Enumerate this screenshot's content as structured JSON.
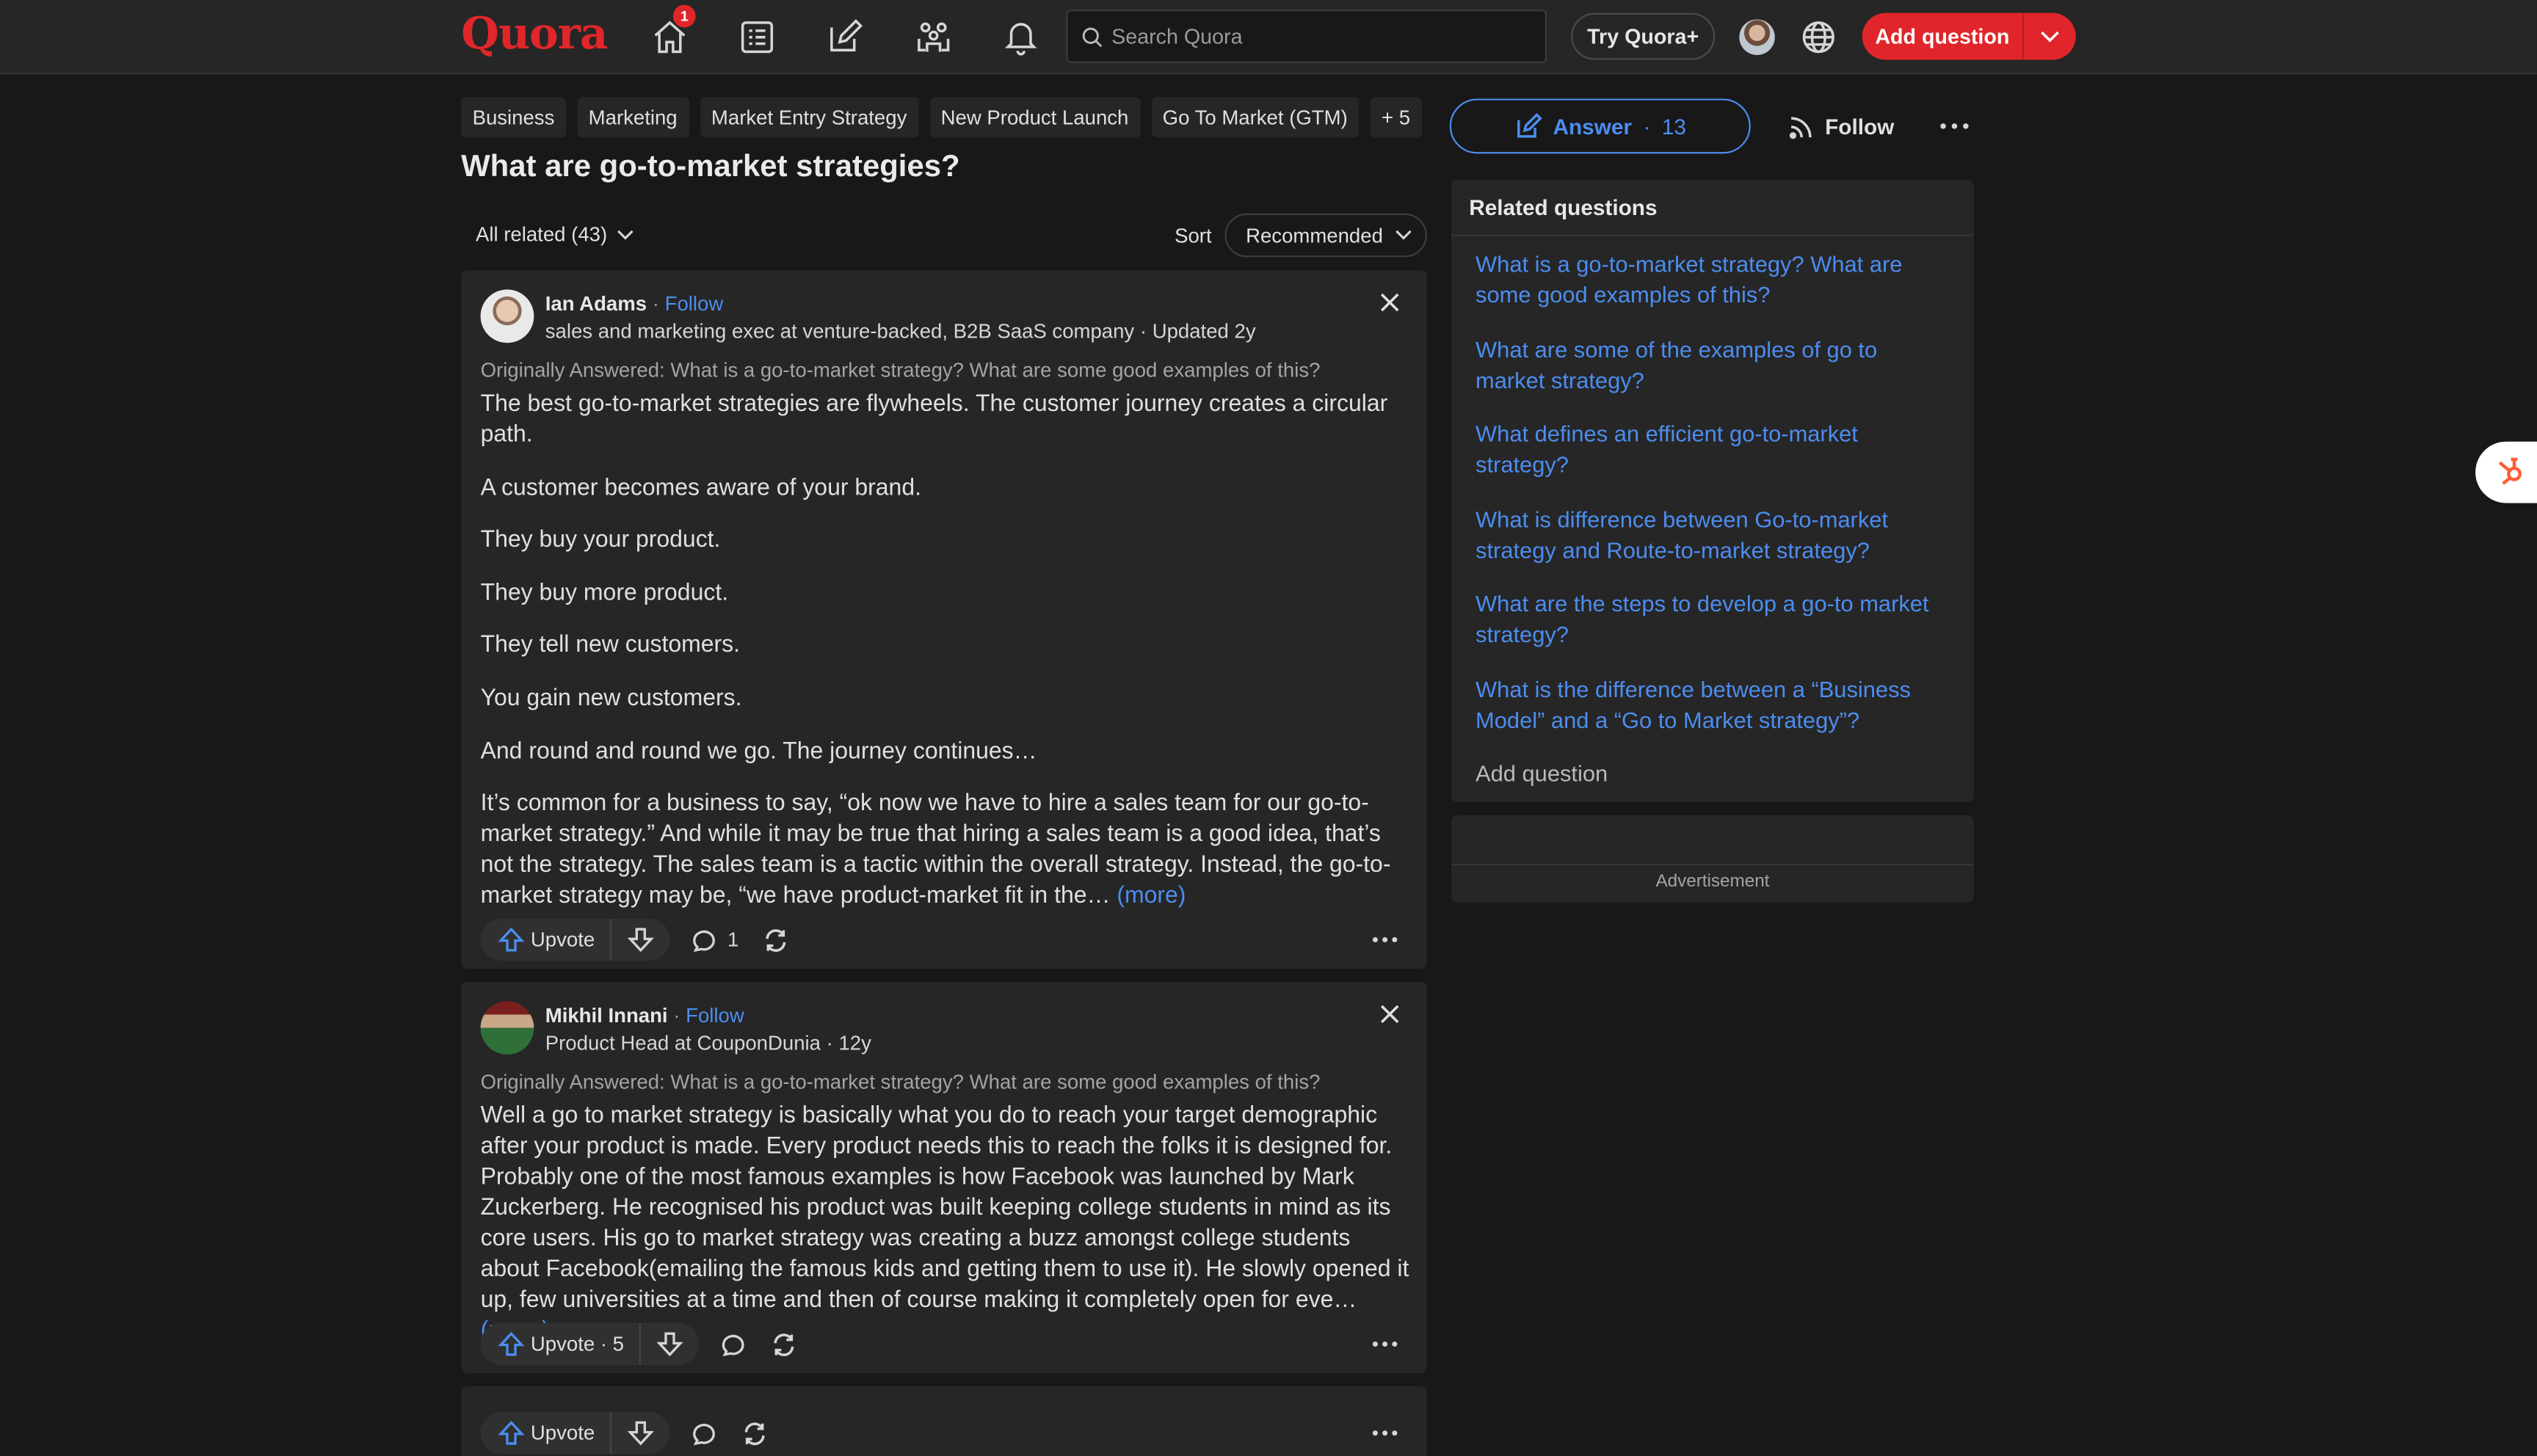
{
  "header": {
    "logo": "Quora",
    "notification_badge": "1",
    "search_placeholder": "Search Quora",
    "try_plus": "Try Quora+",
    "add_question": "Add question"
  },
  "question": {
    "topics": [
      "Business",
      "Marketing",
      "Market Entry Strategy",
      "New Product Launch",
      "Go To Market (GTM)",
      "+ 5"
    ],
    "title": "What are go-to-market strategies?",
    "filter_label": "All related (43)",
    "sort_label": "Sort",
    "sort_value": "Recommended",
    "answer_label": "Answer",
    "answer_sep": "·",
    "answer_count": "13",
    "follow_label": "Follow"
  },
  "answers": [
    {
      "name": "Ian Adams",
      "sep": "·",
      "follow": "Follow",
      "credential": "sales and marketing exec at venture-backed, B2B SaaS company · Updated 2y",
      "originally": "Originally Answered: What is a go-to-market strategy? What are some good examples of this?",
      "paragraphs": [
        "The best go-to-market strategies are flywheels. The customer journey creates a circular path.",
        "A customer becomes aware of your brand.",
        "They buy your product.",
        "They buy more product.",
        "They tell new customers.",
        "You gain new customers.",
        "And round and round we go. The journey continues…"
      ],
      "last_paragraph": "It’s common for a business to say, “ok now we have to hire a sales team for our go-to-market strategy.” And while it may be true that hiring a sales team is a good idea, that’s not the strategy. The sales team is a tactic within the overall strategy. Instead, the go-to-market strategy may be, “we have product-market fit in the…",
      "more": "(more)",
      "upvote": "Upvote",
      "comments": "1"
    },
    {
      "name": "Mikhil Innani",
      "sep": "·",
      "follow": "Follow",
      "credential": "Product Head at CouponDunia · 12y",
      "originally": "Originally Answered: What is a go-to-market strategy? What are some good examples of this?",
      "last_paragraph": "Well a go to market strategy is basically what you do to reach your target demographic after your product is made. Every product needs this to reach the folks it is designed for. Probably one of the most famous examples is how Facebook was launched by Mark Zuckerberg. He recognised his product was built keeping college students in mind as its core users. His go to market strategy was creating a buzz amongst college students about Facebook(emailing the famous kids and getting them to use it). He slowly opened it up, few universities at a time and then of course making it completely open for eve…",
      "more": "(more)",
      "upvote": "Upvote · 5"
    },
    {
      "upvote": "Upvote"
    }
  ],
  "related": {
    "header": "Related questions",
    "items": [
      "What is a go-to-market strategy? What are some good examples of this?",
      "What are some of the examples of go to market strategy?",
      "What defines an efficient go-to-market strategy?",
      "What is difference between Go-to-market strategy and Route-to-market strategy?",
      "What are the steps to develop a go-to market strategy?",
      "What is the difference between a “Business Model” and a “Go to Market strategy”?"
    ],
    "add_question": "Add question"
  },
  "ad": {
    "label": "Advertisement"
  },
  "colors": {
    "brand": "#e0262a",
    "link": "#4c8df0",
    "bg": "#181818",
    "card": "#262626"
  },
  "icons": [
    "home-icon",
    "following-icon",
    "answer-icon",
    "spaces-icon",
    "notifications-icon",
    "search-icon",
    "globe-icon",
    "chevron-down-icon",
    "close-icon",
    "upvote-icon",
    "downvote-icon",
    "comment-icon",
    "share-icon",
    "more-icon",
    "rss-icon",
    "pencil-icon",
    "hubspot-icon"
  ]
}
